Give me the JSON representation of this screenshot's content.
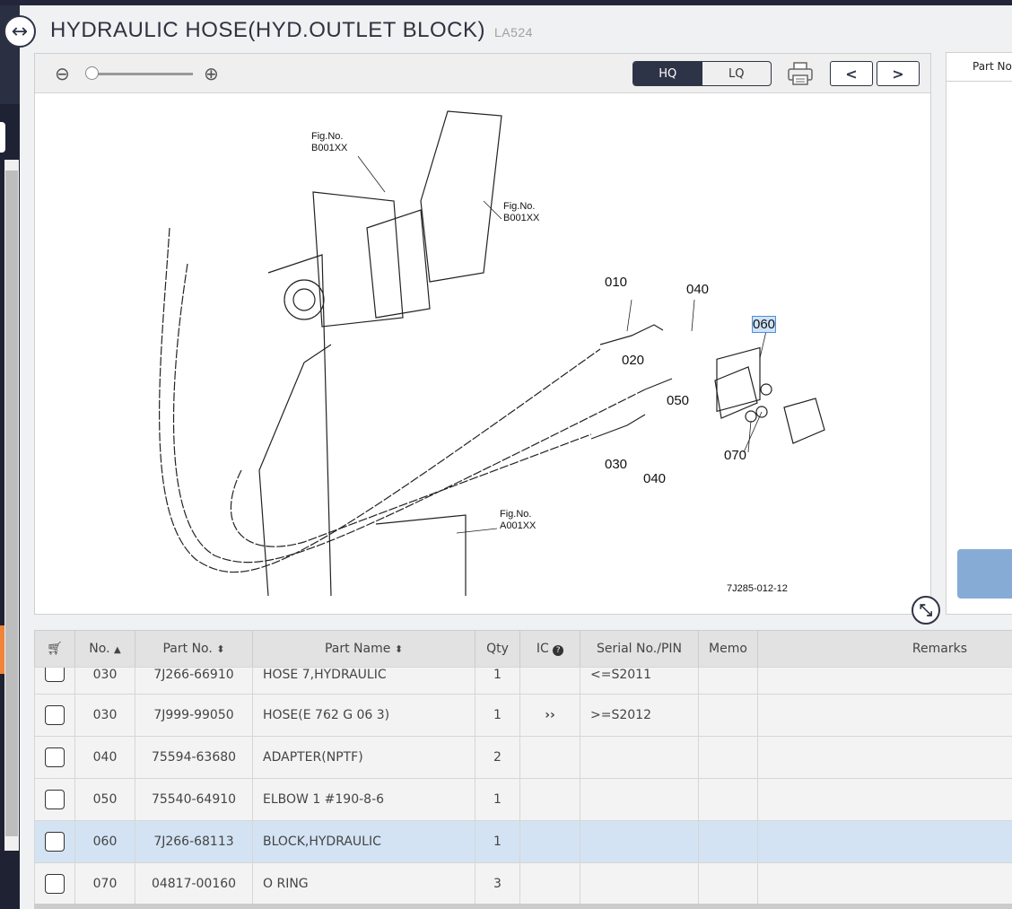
{
  "header": {
    "title": "HYDRAULIC HOSE(HYD.OUTLET BLOCK)",
    "code": "LA524"
  },
  "toolbar": {
    "hq_label": "HQ",
    "lq_label": "LQ",
    "quality_selected": "HQ",
    "zoom_level": 0
  },
  "drawing": {
    "labels": {
      "fig_b1": "Fig.No.\nB001XX",
      "fig_b2": "Fig.No.\nB001XX",
      "fig_a": "Fig.No.\nA001XX",
      "p010": "010",
      "p040a": "040",
      "p060": "060",
      "p020": "020",
      "p050": "050",
      "p030": "030",
      "p040b": "040",
      "p070": "070",
      "drawing_no": "7J285-012-12"
    },
    "highlighted": "060"
  },
  "right_panel": {
    "header": "Part No"
  },
  "table": {
    "columns": {
      "no": "No.",
      "part_no": "Part No.",
      "part_name": "Part Name",
      "qty": "Qty",
      "ic": "IC",
      "serial": "Serial No./PIN",
      "memo": "Memo",
      "remarks": "Remarks"
    },
    "rows": [
      {
        "no": "030",
        "part_no": "7J266-66910",
        "name": "HOSE 7,HYDRAULIC",
        "qty": "1",
        "ic": "",
        "serial": "<=S2011",
        "memo": "",
        "remarks": ""
      },
      {
        "no": "030",
        "part_no": "7J999-99050",
        "name": "HOSE(E 762 G 06 3)",
        "qty": "1",
        "ic": "››",
        "serial": ">=S2012",
        "memo": "",
        "remarks": ""
      },
      {
        "no": "040",
        "part_no": "75594-63680",
        "name": "ADAPTER(NPTF)",
        "qty": "2",
        "ic": "",
        "serial": "",
        "memo": "",
        "remarks": ""
      },
      {
        "no": "050",
        "part_no": "75540-64910",
        "name": "ELBOW 1 #190-8-6",
        "qty": "1",
        "ic": "",
        "serial": "",
        "memo": "",
        "remarks": ""
      },
      {
        "no": "060",
        "part_no": "7J266-68113",
        "name": "BLOCK,HYDRAULIC",
        "qty": "1",
        "ic": "",
        "serial": "",
        "memo": "",
        "remarks": "",
        "selected": true
      },
      {
        "no": "070",
        "part_no": "04817-00160",
        "name": "O RING",
        "qty": "3",
        "ic": "",
        "serial": "",
        "memo": "",
        "remarks": ""
      }
    ]
  },
  "colors": {
    "dark": "#2e3447",
    "selected_row": "#d3e3f3",
    "accent_orange": "#f0843a",
    "blue_button": "#86acd6"
  }
}
